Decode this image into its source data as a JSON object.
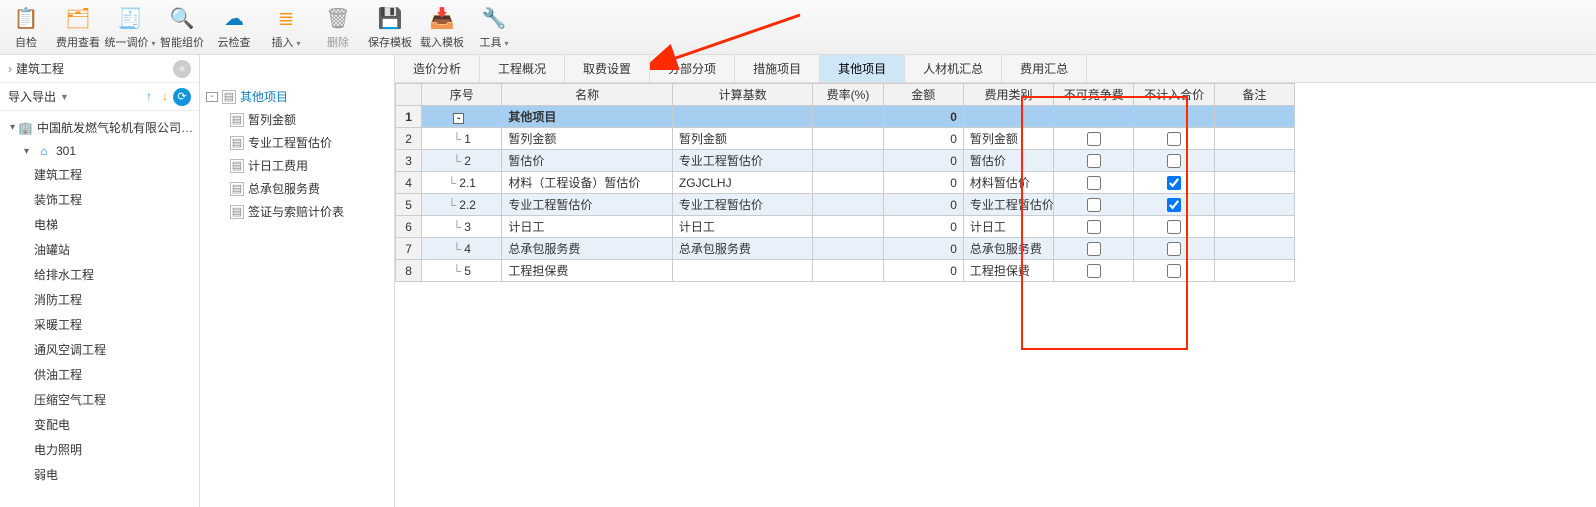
{
  "toolbar": [
    {
      "id": "self-check",
      "label": "自检",
      "icon": "📋",
      "cls": "ico-blue"
    },
    {
      "id": "fee-view",
      "label": "费用查看",
      "icon": "🗂",
      "cls": "ico-orange"
    },
    {
      "id": "unify-price",
      "label": "统一调价",
      "icon": "🧾",
      "cls": "ico-orange",
      "dd": true
    },
    {
      "id": "smart-quote",
      "label": "智能组价",
      "icon": "🔍",
      "cls": "ico-orange"
    },
    {
      "id": "cloud-check",
      "label": "云检查",
      "icon": "☁",
      "cls": "ico-blue"
    },
    {
      "id": "insert",
      "label": "插入",
      "icon": "≣",
      "cls": "ico-orange",
      "dd": true
    },
    {
      "id": "delete",
      "label": "删除",
      "icon": "🗑",
      "cls": "ico-grey",
      "disabled": true
    },
    {
      "id": "save-tpl",
      "label": "保存模板",
      "icon": "💾",
      "cls": "ico-orange"
    },
    {
      "id": "load-tpl",
      "label": "载入模板",
      "icon": "📥",
      "cls": "ico-orange"
    },
    {
      "id": "tools",
      "label": "工具",
      "icon": "🔧",
      "cls": "ico-blue",
      "dd": true
    }
  ],
  "left": {
    "crumb_icon": "›",
    "crumb": "建筑工程",
    "import_export": "导入导出",
    "root_label": "中国航发燃气轮机有限公司…",
    "node_301": "301",
    "leaves": [
      "建筑工程",
      "装饰工程",
      "电梯",
      "油罐站",
      "给排水工程",
      "消防工程",
      "采暖工程",
      "通风空调工程",
      "供油工程",
      "压缩空气工程",
      "变配电",
      "电力照明",
      "弱电"
    ]
  },
  "mid": {
    "root": "其他项目",
    "items": [
      "暂列金额",
      "专业工程暂估价",
      "计日工费用",
      "总承包服务费",
      "签证与索赔计价表"
    ]
  },
  "tabs": [
    "造价分析",
    "工程概况",
    "取费设置",
    "分部分项",
    "措施项目",
    "其他项目",
    "人材机汇总",
    "费用汇总"
  ],
  "active_tab": 5,
  "grid": {
    "headers": [
      "",
      "序号",
      "名称",
      "计算基数",
      "费率(%)",
      "金额",
      "费用类别",
      "不可竞争费",
      "不计入合价",
      "备注"
    ],
    "rows": [
      {
        "rn": "1",
        "seq": "",
        "name": "其他项目",
        "base": "",
        "rate": "",
        "amt": "0",
        "cat": "",
        "ncomp": null,
        "nincl": null,
        "hdr": true,
        "tog": "-"
      },
      {
        "rn": "2",
        "seq": "1",
        "name": "暂列金额",
        "base": "暂列金额",
        "rate": "",
        "amt": "0",
        "cat": "暂列金额",
        "ncomp": false,
        "nincl": false
      },
      {
        "rn": "3",
        "seq": "2",
        "name": "暂估价",
        "base": "专业工程暂估价",
        "rate": "",
        "amt": "0",
        "cat": "暂估价",
        "ncomp": false,
        "nincl": false,
        "zebra": true
      },
      {
        "rn": "4",
        "seq": "2.1",
        "name": "材料（工程设备）暂估价",
        "base": "ZGJCLHJ",
        "rate": "",
        "amt": "0",
        "cat": "材料暂估价",
        "ncomp": false,
        "nincl": true
      },
      {
        "rn": "5",
        "seq": "2.2",
        "name": "专业工程暂估价",
        "base": "专业工程暂估价",
        "rate": "",
        "amt": "0",
        "cat": "专业工程暂估价",
        "ncomp": false,
        "nincl": true,
        "zebra": true
      },
      {
        "rn": "6",
        "seq": "3",
        "name": "计日工",
        "base": "计日工",
        "rate": "",
        "amt": "0",
        "cat": "计日工",
        "ncomp": false,
        "nincl": false
      },
      {
        "rn": "7",
        "seq": "4",
        "name": "总承包服务费",
        "base": "总承包服务费",
        "rate": "",
        "amt": "0",
        "cat": "总承包服务费",
        "ncomp": false,
        "nincl": false,
        "zebra": true
      },
      {
        "rn": "8",
        "seq": "5",
        "name": "工程担保费",
        "base": "",
        "rate": "",
        "amt": "0",
        "cat": "工程担保费",
        "ncomp": false,
        "nincl": false
      }
    ]
  }
}
